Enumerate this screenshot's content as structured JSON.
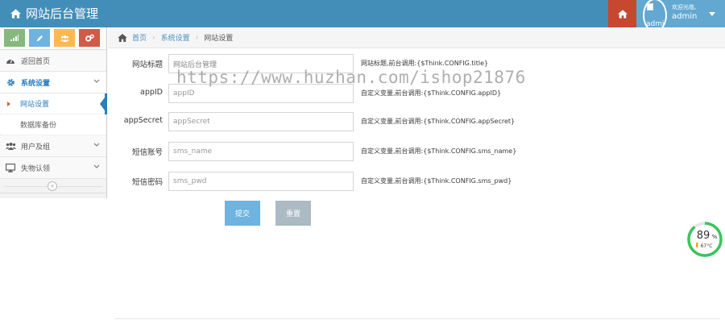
{
  "navbar": {
    "title": "网站后台管理",
    "welcome": "欢迎光临,",
    "username": "admin",
    "avatar_alt": "admin"
  },
  "sidebar": {
    "items": [
      {
        "label": "返回首页",
        "icon": "tachometer-icon"
      },
      {
        "label": "系统设置",
        "icon": "gear-icon",
        "expanded": true,
        "children": [
          {
            "label": "网站设置",
            "active": true
          },
          {
            "label": "数据库备份",
            "active": false
          }
        ]
      },
      {
        "label": "用户及组",
        "icon": "users-icon"
      },
      {
        "label": "失物认领",
        "icon": "desktop-icon"
      }
    ],
    "collapse_icon": "double-chevron-left-icon"
  },
  "breadcrumb": {
    "home": "首页",
    "section": "系统设置",
    "current": "网站设置"
  },
  "form": {
    "fields": [
      {
        "label": "网站标题",
        "value": "网站后台管理",
        "placeholder": "",
        "help": "网站标题,前台调用:{$Think.CONFIG.title}"
      },
      {
        "label": "appID",
        "value": "",
        "placeholder": "appID",
        "help": "自定义变量,前台调用:{$Think.CONFIG.appID}"
      },
      {
        "label": "appSecret",
        "value": "",
        "placeholder": "appSecret",
        "help": "自定义变量,前台调用:{$Think.CONFIG.appSecret}"
      },
      {
        "label": "短信账号",
        "value": "",
        "placeholder": "sms_name",
        "help": "自定义变量,前台调用:{$Think.CONFIG.sms_name}"
      },
      {
        "label": "短信密码",
        "value": "",
        "placeholder": "sms_pwd",
        "help": "自定义变量,前台调用:{$Think.CONFIG.sms_pwd}"
      }
    ],
    "submit_label": "提交",
    "reset_label": "重置"
  },
  "watermark": "https://www.huzhan.com/ishop21876",
  "system_monitor": {
    "load_percent": "89",
    "percent_sign": "%",
    "temperature": "67°C",
    "load_fraction": 0.89
  },
  "colors": {
    "navbar": "#438eb9",
    "home_button": "#c6482f",
    "user_area": "#62a8d1",
    "accent": "#2b7dbc",
    "submit": "#6fb3e0",
    "reset": "#abbac3",
    "gauge": "#3bc45a"
  }
}
